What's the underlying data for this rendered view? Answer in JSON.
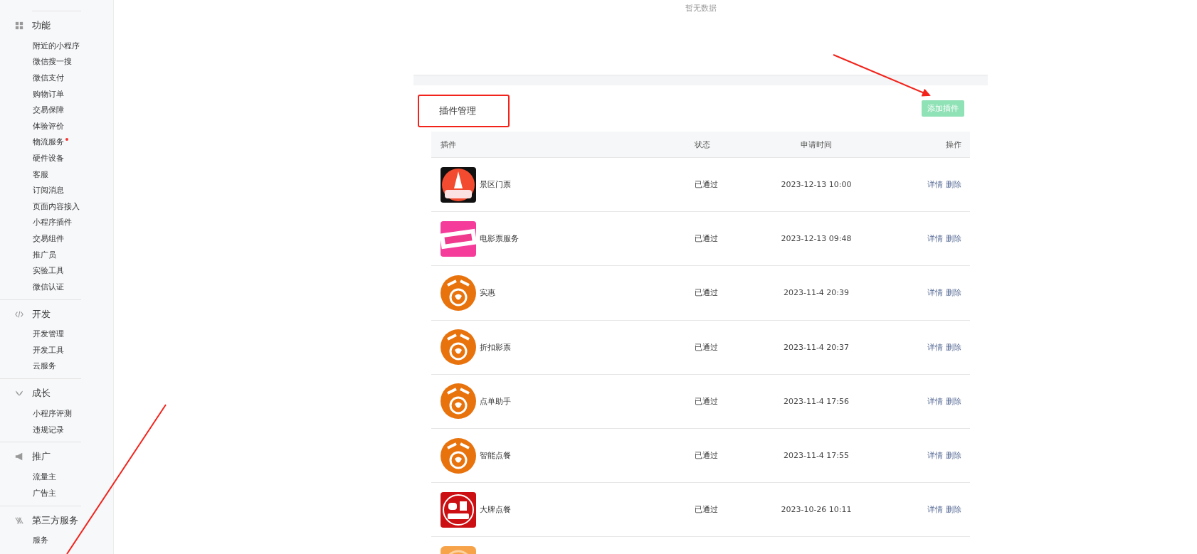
{
  "sidebar": {
    "sections": [
      {
        "title": "功能",
        "items": [
          {
            "label": "附近的小程序",
            "badge": false
          },
          {
            "label": "微信搜一搜",
            "badge": false
          },
          {
            "label": "微信支付",
            "badge": false
          },
          {
            "label": "购物订单",
            "badge": false
          },
          {
            "label": "交易保障",
            "badge": false
          },
          {
            "label": "体验评价",
            "badge": false
          },
          {
            "label": "物流服务",
            "badge": true
          },
          {
            "label": "硬件设备",
            "badge": false
          },
          {
            "label": "客服",
            "badge": false
          },
          {
            "label": "订阅消息",
            "badge": false
          },
          {
            "label": "页面内容接入",
            "badge": false
          },
          {
            "label": "小程序插件",
            "badge": false
          },
          {
            "label": "交易组件",
            "badge": false
          },
          {
            "label": "推广员",
            "badge": false
          },
          {
            "label": "实验工具",
            "badge": false
          },
          {
            "label": "微信认证",
            "badge": false
          }
        ]
      },
      {
        "title": "开发",
        "items": [
          {
            "label": "开发管理",
            "badge": false
          },
          {
            "label": "开发工具",
            "badge": false
          },
          {
            "label": "云服务",
            "badge": false
          }
        ]
      },
      {
        "title": "成长",
        "items": [
          {
            "label": "小程序评测",
            "badge": false
          },
          {
            "label": "违规记录",
            "badge": false
          }
        ]
      },
      {
        "title": "推广",
        "items": [
          {
            "label": "流量主",
            "badge": false
          },
          {
            "label": "广告主",
            "badge": false
          }
        ]
      },
      {
        "title": "第三方服务",
        "items": [
          {
            "label": "服务",
            "badge": false
          }
        ]
      }
    ]
  },
  "empty_card": {
    "message": "暂无数据"
  },
  "plugins": {
    "title": "插件管理",
    "add_button": {
      "label": "添加插件",
      "disabled": true
    },
    "columns": [
      "插件",
      "状态",
      "申请时间",
      "操作"
    ],
    "rows": [
      {
        "kind": "picture",
        "name": "景区门票",
        "status": "已通过",
        "time": "2023-12-13 10:00",
        "actions": [
          "详情",
          "删除"
        ]
      },
      {
        "kind": "picture",
        "name": "电影票服务",
        "status": "已通过",
        "time": "2023-12-13 09:48",
        "actions": [
          "详情",
          "删除"
        ]
      },
      {
        "kind": "picture",
        "name": "实惠",
        "status": "已通过",
        "time": "2023-11-4 20:39",
        "actions": [
          "详情",
          "删除"
        ]
      },
      {
        "kind": "picture",
        "name": "折扣影票",
        "status": "已通过",
        "time": "2023-11-4 20:37",
        "actions": [
          "详情",
          "删除"
        ]
      },
      {
        "kind": "picture",
        "name": "点单助手",
        "status": "已通过",
        "time": "2023-11-4 17:56",
        "actions": [
          "详情",
          "删除"
        ]
      },
      {
        "kind": "picture",
        "name": "智能点餐",
        "status": "已通过",
        "time": "2023-11-4 17:55",
        "actions": [
          "详情",
          "删除"
        ]
      },
      {
        "kind": "picture",
        "name": "大牌点餐",
        "status": "已通过",
        "time": "2023-10-26 10:11",
        "actions": [
          "详情",
          "删除"
        ]
      },
      {
        "kind": "picture"
      }
    ]
  }
}
